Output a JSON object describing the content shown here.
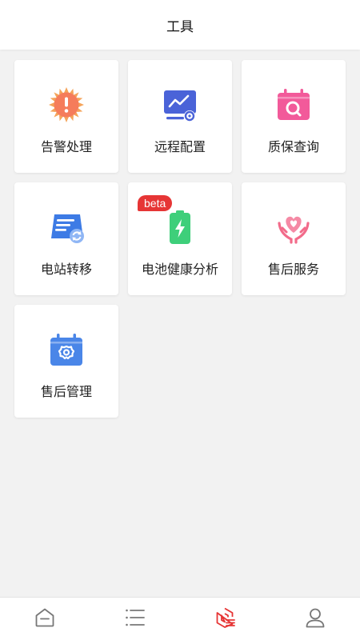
{
  "header": {
    "title": "工具"
  },
  "tools": [
    {
      "label": "告警处理",
      "icon": "alarm-icon",
      "color": "#f57c5b"
    },
    {
      "label": "远程配置",
      "icon": "remote-config-icon",
      "color": "#4a63d8"
    },
    {
      "label": "质保查询",
      "icon": "warranty-search-icon",
      "color": "#f25a9a"
    },
    {
      "label": "电站转移",
      "icon": "station-transfer-icon",
      "color": "#3d7be5"
    },
    {
      "label": "电池健康分析",
      "icon": "battery-health-icon",
      "color": "#3ecf7a",
      "badge": "beta"
    },
    {
      "label": "售后服务",
      "icon": "aftersales-service-icon",
      "color": "#f26b8a"
    },
    {
      "label": "售后管理",
      "icon": "aftersales-management-icon",
      "color": "#4a86e8"
    }
  ],
  "tabbar": {
    "tabs": [
      {
        "icon": "home-icon",
        "active": false
      },
      {
        "icon": "list-icon",
        "active": false
      },
      {
        "icon": "tools-icon",
        "active": true
      },
      {
        "icon": "user-icon",
        "active": false
      }
    ],
    "active_color": "#e63535",
    "inactive_color": "#777777"
  }
}
